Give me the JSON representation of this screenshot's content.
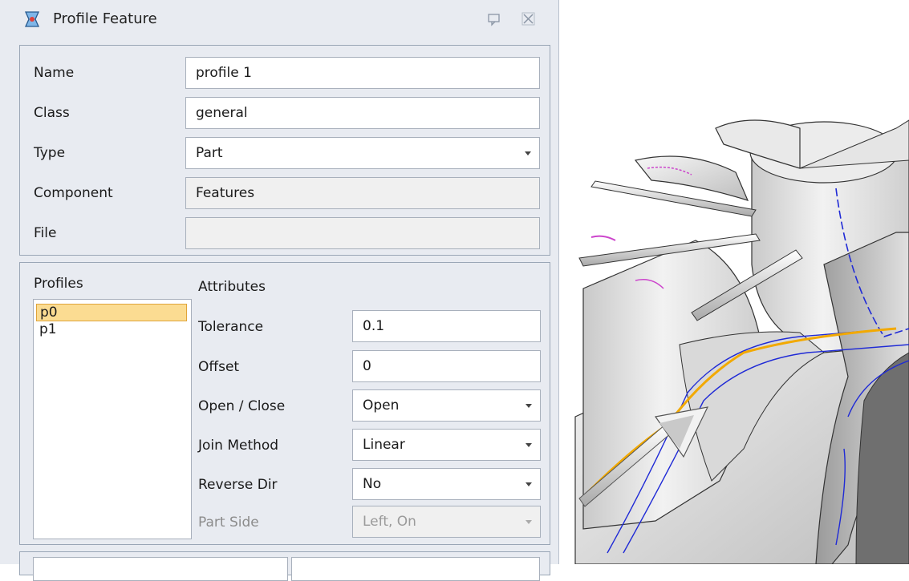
{
  "panel": {
    "title": "Profile Feature",
    "icons": {
      "app": "profile-feature-icon",
      "pin": "pin-icon",
      "close": "close-icon"
    }
  },
  "properties": {
    "name": {
      "label": "Name",
      "value": "profile 1"
    },
    "class": {
      "label": "Class",
      "value": "general"
    },
    "type": {
      "label": "Type",
      "value": "Part"
    },
    "component": {
      "label": "Component",
      "value": "Features"
    },
    "file": {
      "label": "File",
      "value": ""
    }
  },
  "profiles": {
    "header": "Profiles",
    "items": [
      "p0",
      "p1"
    ],
    "selected": "p0"
  },
  "attributes": {
    "header": "Attributes",
    "tolerance": {
      "label": "Tolerance",
      "value": "0.1"
    },
    "offset": {
      "label": "Offset",
      "value": "0"
    },
    "open_close": {
      "label": "Open / Close",
      "value": "Open"
    },
    "join_method": {
      "label": "Join Method",
      "value": "Linear"
    },
    "reverse_dir": {
      "label": "Reverse Dir",
      "value": "No"
    },
    "part_side": {
      "label": "Part Side",
      "value": "Left, On",
      "disabled": true
    }
  },
  "colors": {
    "panel_bg": "#e8ebf1",
    "selection": "#fbdc92",
    "profile_curve": "#f2a900",
    "edge_lines": "#1f2ad6",
    "highlight": "#cc44cc"
  }
}
